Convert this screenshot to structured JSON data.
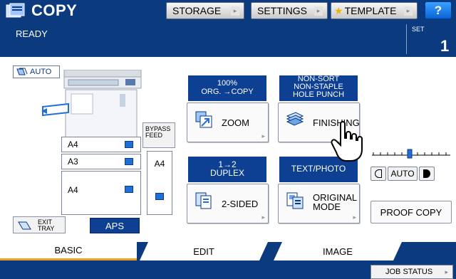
{
  "header": {
    "title": "COPY",
    "status": "READY",
    "set_label": "SET",
    "set_count": "1",
    "buttons": {
      "storage": "STORAGE",
      "settings": "SETTINGS",
      "template": "TEMPLATE",
      "help": "?"
    }
  },
  "original": {
    "auto_label": "AUTO"
  },
  "trays": [
    {
      "size": "A4"
    },
    {
      "size": "A3"
    },
    {
      "size": "A4"
    }
  ],
  "bypass": {
    "button_line1": "BYPASS",
    "button_line2": "FEED",
    "size": "A4"
  },
  "exit_tray": {
    "line1": "EXIT",
    "line2": "TRAY"
  },
  "aps_label": "APS",
  "functions": {
    "zoom": {
      "info_line1": "100%",
      "info_line2": "ORG. →COPY",
      "label": "ZOOM"
    },
    "finishing": {
      "info_line1": "NON-SORT",
      "info_line2": "NON-STAPLE",
      "info_line3": "HOLE PUNCH",
      "label": "FINISHING"
    },
    "two_sided": {
      "info_line1": "1→2",
      "info_line2": "DUPLEX",
      "label": "2-SIDED"
    },
    "original_mode": {
      "info_line1": "TEXT/PHOTO",
      "label_line1": "ORIGINAL",
      "label_line2": "MODE"
    }
  },
  "density": {
    "auto_label": "AUTO"
  },
  "proof_copy": "PROOF COPY",
  "tabs": {
    "basic": "BASIC",
    "edit": "EDIT",
    "image": "IMAGE"
  },
  "job_status": "JOB STATUS",
  "colors": {
    "header_bg": "#0b3a7e",
    "label_bg": "#0d3f92",
    "tab_accent": "#f0a020"
  }
}
